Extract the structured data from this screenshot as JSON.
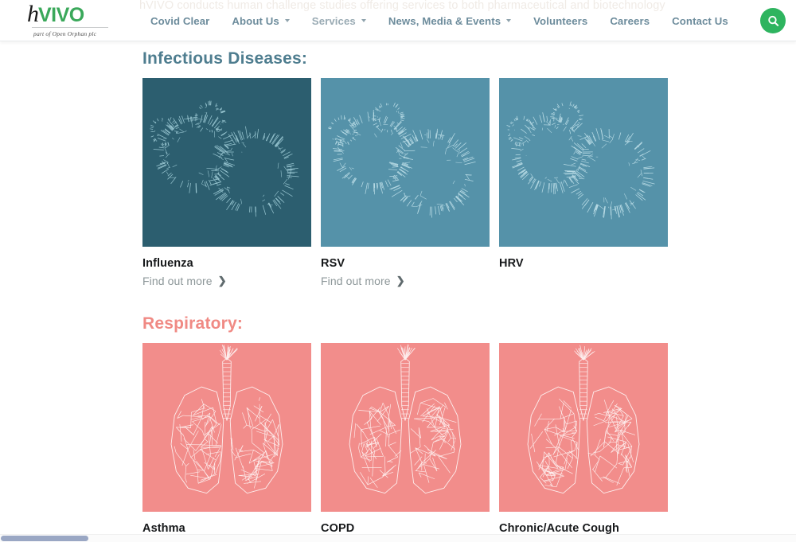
{
  "header": {
    "ghost_text": "hVIVO conducts human challenge studies offering services to both pharmaceutical and biotechnology",
    "logo": {
      "mark_h": "h",
      "mark_vivo": "VIVO",
      "tagline": "part of Open Orphan plc"
    },
    "nav": [
      {
        "label": "Covid Clear",
        "has_caret": false,
        "style": "bold"
      },
      {
        "label": "About Us",
        "has_caret": true,
        "style": "bold"
      },
      {
        "label": "Services",
        "has_caret": true,
        "style": "light"
      },
      {
        "label": "News, Media & Events",
        "has_caret": true,
        "style": "bold"
      },
      {
        "label": "Volunteers",
        "has_caret": false,
        "style": "bold"
      },
      {
        "label": "Careers",
        "has_caret": false,
        "style": "bold"
      },
      {
        "label": "Contact Us",
        "has_caret": false,
        "style": "bold"
      }
    ],
    "search_icon": "search-icon",
    "search_button_color": "#2eb45f"
  },
  "sections": [
    {
      "heading": "Infectious Diseases:",
      "heading_color": "#4e7d8f",
      "cards": [
        {
          "title": "Influenza",
          "link": "Find out more",
          "chevron": "❯",
          "bg": "#2c5e6f",
          "art": "virus"
        },
        {
          "title": "RSV",
          "link": "Find out more",
          "chevron": "❯",
          "bg": "#5592a9",
          "art": "virus"
        },
        {
          "title": "HRV",
          "link": "",
          "chevron": "",
          "bg": "#5592a9",
          "art": "virus"
        }
      ]
    },
    {
      "heading": "Respiratory:",
      "heading_color": "#f08a84",
      "cards": [
        {
          "title": "Asthma",
          "link": "",
          "chevron": "",
          "bg": "#f28d8b",
          "art": "lungs"
        },
        {
          "title": "COPD",
          "link": "",
          "chevron": "",
          "bg": "#f28d8b",
          "art": "lungs"
        },
        {
          "title": "Chronic/Acute Cough",
          "link": "",
          "chevron": "",
          "bg": "#f28d8b",
          "art": "lungs"
        }
      ]
    }
  ],
  "scrollbar": {
    "orientation": "horizontal",
    "thumb_color": "#9aa7c4"
  }
}
